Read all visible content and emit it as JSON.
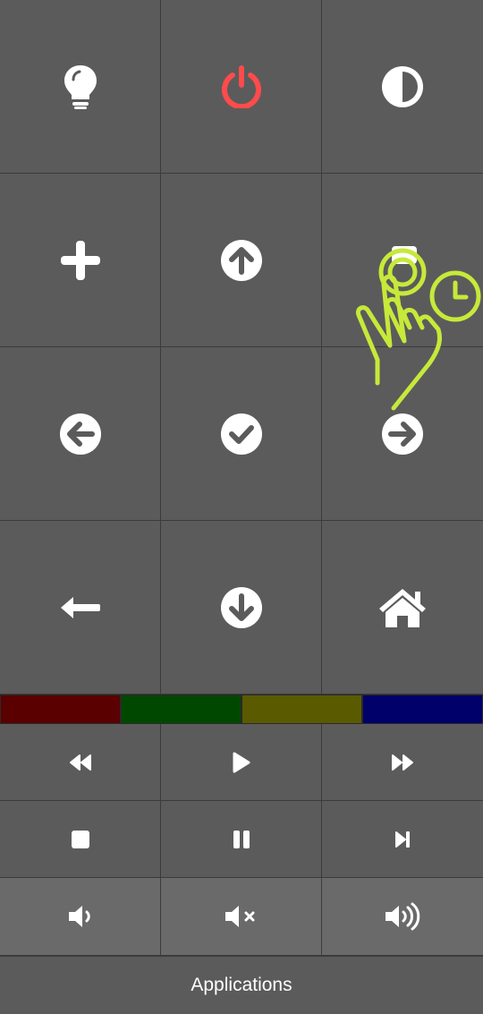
{
  "buttons": {
    "row1": [
      "bulb-icon",
      "power-icon",
      "contrast-icon"
    ],
    "row2": [
      "plus-icon",
      "arrow-up-circle-icon",
      "subtitles-icon"
    ],
    "row3": [
      "arrow-left-circle-icon",
      "check-circle-icon",
      "arrow-right-circle-icon"
    ],
    "row4": [
      "back-arrow-icon",
      "arrow-down-circle-icon",
      "home-icon"
    ]
  },
  "color_keys": [
    "#5a0000",
    "#004800",
    "#5a5a00",
    "#00006a"
  ],
  "media": [
    "rewind-icon",
    "play-icon",
    "fast-forward-icon",
    "stop-icon",
    "pause-icon",
    "skip-next-icon"
  ],
  "volume": [
    "volume-down-icon",
    "mute-icon",
    "volume-up-icon"
  ],
  "apps_button": {
    "label": "Applications"
  },
  "colors": {
    "background": "#5b5b5b",
    "icon": "#ffffff",
    "power": "#ff4b4b",
    "gesture": "#c6e93a"
  }
}
